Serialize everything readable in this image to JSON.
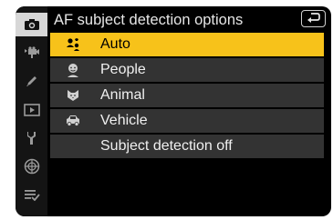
{
  "menu": {
    "title": "AF subject detection options",
    "back_icon": "return-arrow-icon",
    "options": [
      {
        "label": "Auto",
        "icon": "auto-subject-icon",
        "selected": true
      },
      {
        "label": "People",
        "icon": "person-face-icon",
        "selected": false
      },
      {
        "label": "Animal",
        "icon": "animal-face-icon",
        "selected": false
      },
      {
        "label": "Vehicle",
        "icon": "car-icon",
        "selected": false
      },
      {
        "label": "Subject detection off",
        "icon": "",
        "selected": false
      }
    ]
  },
  "sidebar": {
    "items": [
      {
        "icon": "camera-icon",
        "active": true
      },
      {
        "icon": "video-camera-icon",
        "active": false
      },
      {
        "icon": "pencil-icon",
        "active": false
      },
      {
        "icon": "playback-icon",
        "active": false
      },
      {
        "icon": "wrench-icon",
        "active": false
      },
      {
        "icon": "network-icon",
        "active": false
      },
      {
        "icon": "my-menu-icon",
        "active": false
      }
    ]
  },
  "colors": {
    "selection": "#f7c21a",
    "row_background": "#333333",
    "screen_background": "#000000",
    "sidebar_active": "#d7d7d7"
  }
}
